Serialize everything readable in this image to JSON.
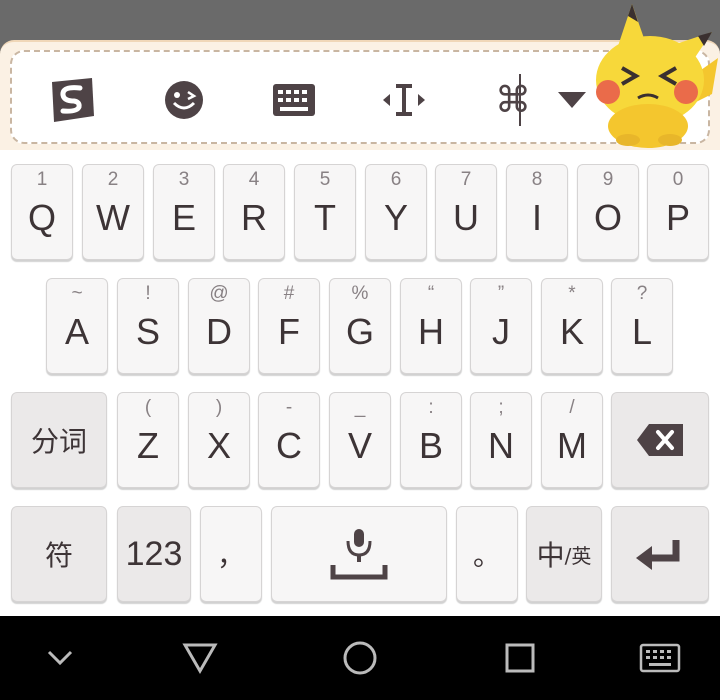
{
  "keyboard": {
    "row1": [
      {
        "key": "Q",
        "hint": "1"
      },
      {
        "key": "W",
        "hint": "2"
      },
      {
        "key": "E",
        "hint": "3"
      },
      {
        "key": "R",
        "hint": "4"
      },
      {
        "key": "T",
        "hint": "5"
      },
      {
        "key": "Y",
        "hint": "6"
      },
      {
        "key": "U",
        "hint": "7"
      },
      {
        "key": "I",
        "hint": "8"
      },
      {
        "key": "O",
        "hint": "9"
      },
      {
        "key": "P",
        "hint": "0"
      }
    ],
    "row2": [
      {
        "key": "A",
        "hint": "~"
      },
      {
        "key": "S",
        "hint": "!"
      },
      {
        "key": "D",
        "hint": "@"
      },
      {
        "key": "F",
        "hint": "#"
      },
      {
        "key": "G",
        "hint": "%"
      },
      {
        "key": "H",
        "hint": "“"
      },
      {
        "key": "J",
        "hint": "”"
      },
      {
        "key": "K",
        "hint": "*"
      },
      {
        "key": "L",
        "hint": "?"
      }
    ],
    "row3": [
      {
        "key": "Z",
        "hint": "("
      },
      {
        "key": "X",
        "hint": ")"
      },
      {
        "key": "C",
        "hint": "-"
      },
      {
        "key": "V",
        "hint": "_"
      },
      {
        "key": "B",
        "hint": ":"
      },
      {
        "key": "N",
        "hint": ";"
      },
      {
        "key": "M",
        "hint": "/"
      }
    ],
    "segment_label": "分词",
    "symbol_label": "符",
    "numeric_label": "123",
    "comma_label": "，",
    "period_label": "。",
    "lang_main": "中",
    "lang_alt": "/英"
  },
  "colors": {
    "key_text": "#3d3436",
    "icon": "#4e4346",
    "toolbar_bg": "#fbf1e4",
    "mascot_yellow": "#f7d83a"
  },
  "toolbar_icons": [
    "sogou-logo-icon",
    "emoji-icon",
    "keyboard-icon",
    "cursor-move-icon",
    "clipboard-icon",
    "dropdown-arrow-icon"
  ],
  "nav_icons": [
    "chevron-down-icon",
    "back-icon",
    "home-icon",
    "recents-icon",
    "keyboard-switch-icon"
  ]
}
